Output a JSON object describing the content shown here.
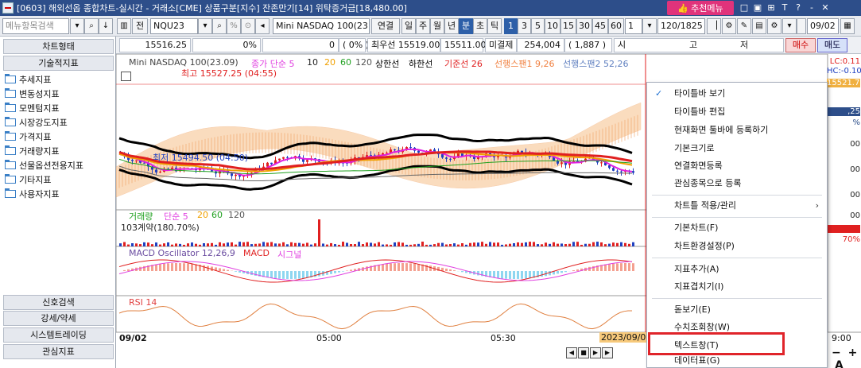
{
  "titlebar": {
    "text": "[0603] 해외선옵 종합차트-실시간 - 거래소[CME] 상품구분[지수] 잔존만기[14] 위탁증거금[18,480.00]",
    "fav_label": "추천메뉴",
    "tools": [
      "□",
      "▣",
      "⊞",
      "T",
      "?",
      "-",
      "✕"
    ]
  },
  "toolbar": {
    "search_placeholder": "메뉴항목검색",
    "type_label": "전",
    "code_value": "NQU23",
    "product_name": "Mini NASDAQ 100(23.0",
    "link_label": "연결",
    "periods": [
      "일",
      "주",
      "월",
      "년",
      "분",
      "초",
      "틱"
    ],
    "selected_period": "분",
    "intervals": [
      "1",
      "3",
      "5",
      "10",
      "15",
      "30",
      "45",
      "60",
      "1"
    ],
    "selected_interval": "1",
    "count_value": "120/1825",
    "date_value": "09/02"
  },
  "row2": {
    "price": "15516.25",
    "change_pct": "0%",
    "volume": "0",
    "vol_pct": "(        0% )",
    "best_ask": "최우선 15519.00",
    "best_bid": "15511.00",
    "unfilled_label": "미결제",
    "unfilled_value": "254,004",
    "unfilled_change": "( 1,887 )",
    "hlc_labels": [
      "시",
      "고",
      "저"
    ],
    "buy_label": "매수",
    "sell_label": "매도"
  },
  "left": {
    "header": "차트형태",
    "subheader": "기술적지표",
    "items": [
      "추세지표",
      "변동성지표",
      "모멘텀지표",
      "시장강도지표",
      "가격지표",
      "거래량지표",
      "선물옵션전용지표",
      "기타지표",
      "사용자지표"
    ],
    "bottom": [
      "신호검색",
      "강세/약세",
      "시스템트레이딩",
      "관심지표"
    ]
  },
  "legend": {
    "price": [
      "Mini NASDAQ 100(23.09)",
      "종가 단순 5",
      "10",
      "20",
      "60",
      "120",
      "상한선",
      "하한선",
      "기준선 26",
      "선행스팬1 9,26",
      "선행스팬2 52,26"
    ],
    "max_label": "최고 15527.25 (04:55)",
    "min_label": "최저 15494.50 (04:50)",
    "volume": [
      "거래량",
      "단순 5",
      "20",
      "60",
      "120"
    ],
    "contract": "103계약(180.70%)",
    "macd": [
      "MACD Oscillator 12,26,9",
      "MACD",
      "시그널"
    ],
    "rsi": "RSI 14",
    "x_date": "09/02",
    "x_ticks": [
      "05:00",
      "05:30"
    ],
    "x_date_box": "2023/09/0",
    "x_right": "9:00"
  },
  "right_axis": {
    "lc": "LC:0.11",
    "hc": "HC:-0.10",
    "price_box": "15521.71",
    "p1": ",25",
    "p2": "%",
    "ticks": [
      "00",
      "00",
      "00",
      "00",
      "00"
    ],
    "pct": "70%"
  },
  "context_menu": {
    "items": [
      {
        "label": "타이틀바 보기",
        "checked": true
      },
      {
        "label": "타이틀바 편집"
      },
      {
        "label": "현재화면 툴바에 등록하기"
      },
      {
        "label": "기본크기로"
      },
      {
        "label": "연결화면등록"
      },
      {
        "label": "관심종목으로 등록"
      },
      {
        "label": "차트틀 적용/관리",
        "submenu": true
      },
      {
        "label": "기본차트(F)"
      },
      {
        "label": "차트환경설정(P)"
      },
      {
        "label": "지표추가(A)"
      },
      {
        "label": "지표겹치기(I)"
      },
      {
        "label": "돋보기(E)"
      },
      {
        "label": "수치조회창(W)"
      },
      {
        "label": "텍스트창(T)",
        "highlighted": true
      },
      {
        "label": "데이터표(G)"
      }
    ]
  },
  "colors": {
    "title_bg": "#2d4e8a",
    "fav_bg": "#e0337b",
    "highlight": "#e0242a",
    "up": "#e02020",
    "down": "#2040c0",
    "ma5": "#e020e0",
    "envelope": "#000000",
    "cloud": "#f0a060"
  }
}
